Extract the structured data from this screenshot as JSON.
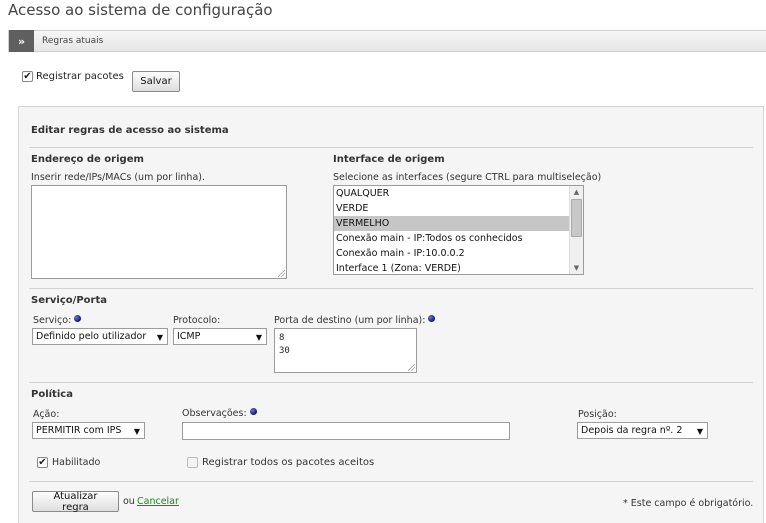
{
  "page_title": "Acesso ao sistema de configuração",
  "section_bar": {
    "label": "Regras atuais"
  },
  "logging": {
    "label": "Registrar pacotes",
    "checked": true,
    "save_label": "Salvar"
  },
  "edit_panel": {
    "title": "Editar regras de acesso ao sistema",
    "source": {
      "heading": "Endereço de origem",
      "hint": "Inserir rede/IPs/MACs (um por linha).",
      "value": ""
    },
    "interface": {
      "heading": "Interface de origem",
      "hint": "Selecione as interfaces (segure CTRL para multiseleção)",
      "options": [
        "QUALQUER",
        "VERDE",
        "VERMELHO",
        "Conexão main - IP:Todos os conhecidos",
        "Conexão main - IP:10.0.0.2",
        "Interface 1 (Zona: VERDE)"
      ],
      "selected": "VERMELHO"
    },
    "service_port": {
      "heading": "Serviço/Porta",
      "service_label": "Serviço:",
      "service_value": "Definido pelo utilizador",
      "protocol_label": "Protocolo:",
      "protocol_value": "ICMP",
      "dest_port_label": "Porta de destino (um por linha):",
      "dest_port_lines": [
        "8",
        "30"
      ]
    },
    "policy": {
      "heading": "Política",
      "action_label": "Ação:",
      "action_value": "PERMITIR com IPS",
      "notes_label": "Observações:",
      "notes_value": "",
      "position_label": "Posição:",
      "position_value": "Depois da regra nº. 2",
      "enabled_label": "Habilitado",
      "enabled_checked": true,
      "log_accepted_label": "Registrar todos os pacotes aceitos",
      "log_accepted_checked": false
    },
    "footer": {
      "update_label": "Atualizar regra",
      "or_text": "ou",
      "cancel_label": "Cancelar",
      "required_note": "* Este campo é obrigatório."
    }
  },
  "colors": {
    "link": "#1a8a1a",
    "required_dot": "#0b1570",
    "selected_option": "#c6c6c6"
  },
  "icons": {
    "bar_toggle": "double-chevron-right-icon",
    "dropdown": "triangle-down-icon",
    "required": "blue-dot-icon"
  }
}
